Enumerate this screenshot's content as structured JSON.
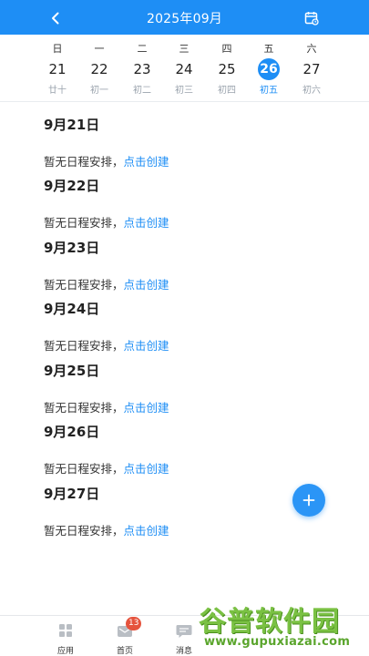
{
  "header": {
    "title": "2025年09月"
  },
  "week": {
    "days": [
      {
        "weekday": "日",
        "day": "21",
        "lunar": "廿十"
      },
      {
        "weekday": "一",
        "day": "22",
        "lunar": "初一"
      },
      {
        "weekday": "二",
        "day": "23",
        "lunar": "初二"
      },
      {
        "weekday": "三",
        "day": "24",
        "lunar": "初三"
      },
      {
        "weekday": "四",
        "day": "25",
        "lunar": "初四"
      },
      {
        "weekday": "五",
        "day": "26",
        "lunar": "初五"
      },
      {
        "weekday": "六",
        "day": "27",
        "lunar": "初六"
      }
    ],
    "selected_index": 5
  },
  "schedule": {
    "groups": [
      {
        "date": "9月21日",
        "empty_text": "暂无日程安排，",
        "create_link": "点击创建"
      },
      {
        "date": "9月22日",
        "empty_text": "暂无日程安排，",
        "create_link": "点击创建"
      },
      {
        "date": "9月23日",
        "empty_text": "暂无日程安排，",
        "create_link": "点击创建"
      },
      {
        "date": "9月24日",
        "empty_text": "暂无日程安排，",
        "create_link": "点击创建"
      },
      {
        "date": "9月25日",
        "empty_text": "暂无日程安排，",
        "create_link": "点击创建"
      },
      {
        "date": "9月26日",
        "empty_text": "暂无日程安排，",
        "create_link": "点击创建"
      },
      {
        "date": "9月27日",
        "empty_text": "暂无日程安排，",
        "create_link": "点击创建"
      }
    ]
  },
  "tabbar": {
    "tabs": [
      {
        "label": "应用",
        "icon": "apps-grid-icon"
      },
      {
        "label": "首页",
        "icon": "home-icon",
        "badge": "13"
      },
      {
        "label": "消息",
        "icon": "message-icon"
      }
    ]
  },
  "watermark": {
    "text": "谷普软件园",
    "url": "www.gupuxiazai.com"
  },
  "colors": {
    "primary": "#1e8ef5",
    "badge": "#e5533d",
    "watermark": "#7ac143"
  }
}
